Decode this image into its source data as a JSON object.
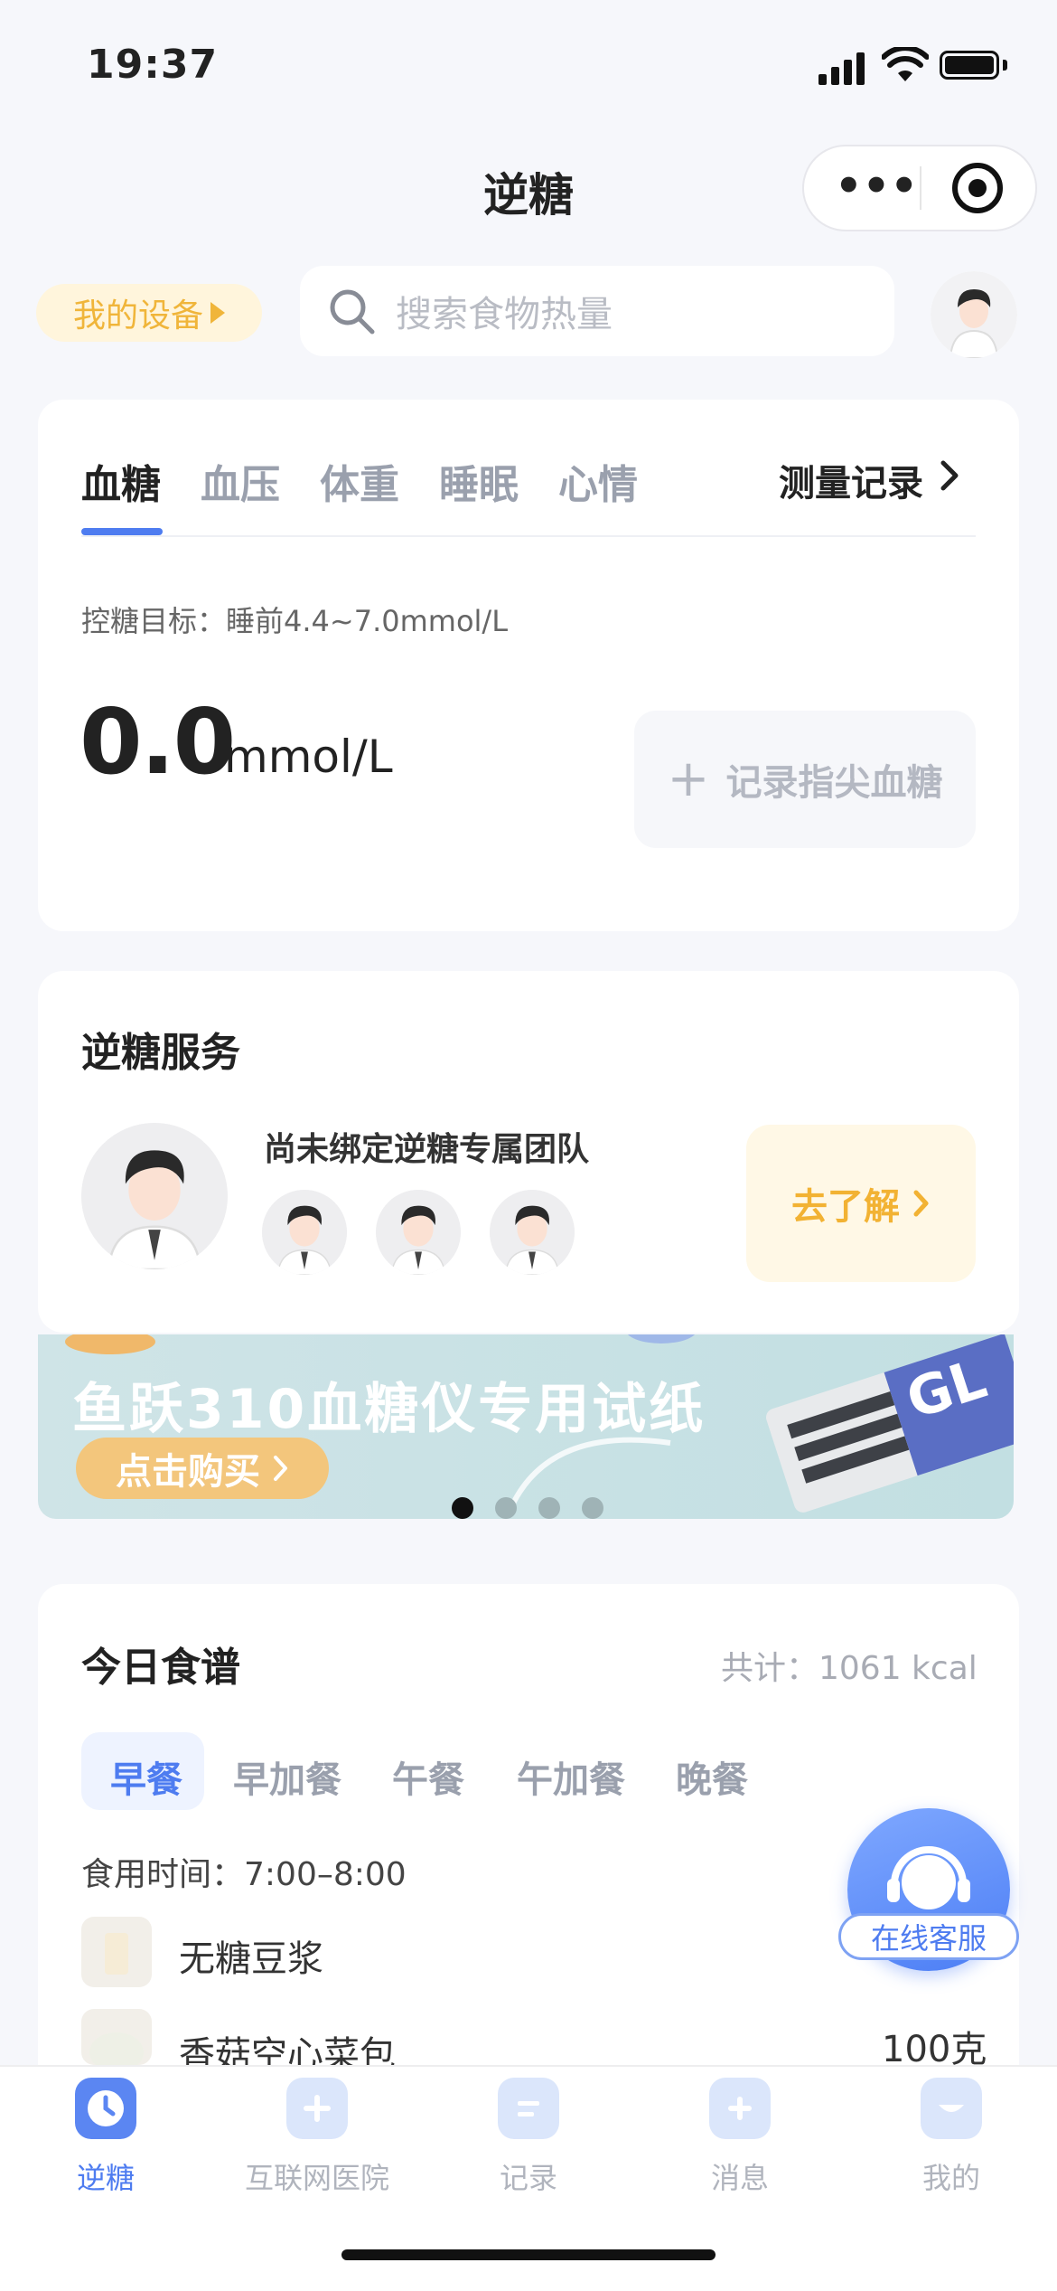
{
  "status_bar": {
    "time": "19:37"
  },
  "header": {
    "title": "逆糖",
    "menu_dots": "•••"
  },
  "top_row": {
    "device_label": "我的设备",
    "search_placeholder": "搜索食物热量"
  },
  "measure_card": {
    "tabs": [
      {
        "label": "血糖"
      },
      {
        "label": "血压"
      },
      {
        "label": "体重"
      },
      {
        "label": "睡眠"
      },
      {
        "label": "心情"
      }
    ],
    "active_tab": "血糖",
    "records_label": "测量记录",
    "goal_text": "控糖目标：睡前4.4~7.0mmol/L",
    "value": "0.0",
    "unit": "mmol/L",
    "record_button": "记录指尖血糖"
  },
  "service_card": {
    "title": "逆糖服务",
    "subtitle": "尚未绑定逆糖专属团队",
    "learn_button": "去了解"
  },
  "banner": {
    "text": "鱼跃310血糖仪专用试纸",
    "button": "点击购买",
    "product_mark": "GL",
    "slide_count": 4,
    "active_slide": 1
  },
  "recipe_card": {
    "title": "今日食谱",
    "total": "共计：1061 kcal",
    "meal_tabs": [
      {
        "label": "早餐"
      },
      {
        "label": "早加餐"
      },
      {
        "label": "午餐"
      },
      {
        "label": "午加餐"
      },
      {
        "label": "晚餐"
      }
    ],
    "active_meal": "早餐",
    "eat_time": "食用时间：7:00–8:00",
    "foods": [
      {
        "name": "无糖豆浆",
        "qty": ""
      },
      {
        "name": "香菇空心菜包",
        "qty": "100克"
      }
    ]
  },
  "float_service": {
    "label": "在线客服"
  },
  "bottom_nav": {
    "items": [
      {
        "label": "逆糖",
        "icon": "clock-icon",
        "active": true
      },
      {
        "label": "互联网医院",
        "icon": "hospital-icon",
        "active": false
      },
      {
        "label": "记录",
        "icon": "clipboard-icon",
        "active": false
      },
      {
        "label": "消息",
        "icon": "message-icon",
        "active": false
      },
      {
        "label": "我的",
        "icon": "profile-icon",
        "active": false
      }
    ]
  },
  "colors": {
    "accent": "#4e7cf0",
    "gold": "#f0b53a",
    "background": "#f6f7fb"
  }
}
